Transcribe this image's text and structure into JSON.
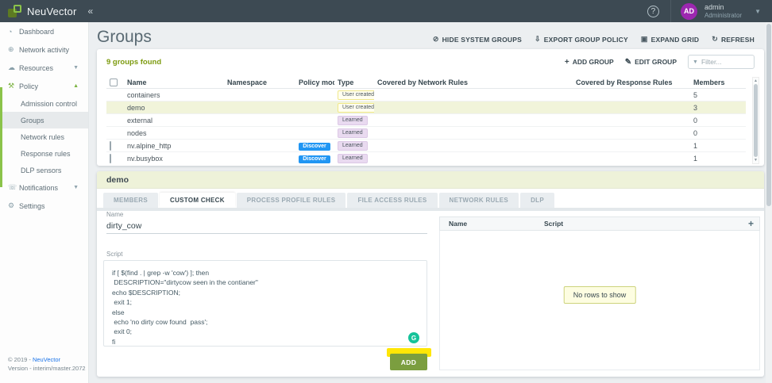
{
  "topbar": {
    "brand": "NeuVector",
    "collapse_icon": "«",
    "help_icon": "?",
    "avatar_initials": "AD",
    "user_name": "admin",
    "user_role": "Administrator",
    "caret_icon": "▼"
  },
  "sidebar": {
    "items": [
      {
        "id": "dashboard",
        "icon": "gauge-icon",
        "glyph": "◔",
        "label": "Dashboard",
        "chevron": ""
      },
      {
        "id": "network-activity",
        "icon": "globe-icon",
        "glyph": "⊕",
        "label": "Network activity",
        "chevron": ""
      },
      {
        "id": "resources",
        "icon": "cloud-icon",
        "glyph": "☁",
        "label": "Resources",
        "chevron": "▼"
      },
      {
        "id": "policy",
        "icon": "gavel-icon",
        "glyph": "⚒",
        "label": "Policy",
        "chevron": "▲",
        "expanded": true,
        "children": [
          "Admission control",
          "Groups",
          "Network rules",
          "Response rules",
          "DLP sensors"
        ],
        "selected_child": "Groups"
      },
      {
        "id": "notifications",
        "icon": "phone-icon",
        "glyph": "☏",
        "label": "Notifications",
        "chevron": "▼"
      },
      {
        "id": "settings",
        "icon": "wrench-icon",
        "glyph": "⚙",
        "label": "Settings",
        "chevron": ""
      }
    ],
    "footer": {
      "copyright": "© 2019 - ",
      "brand_link": "NeuVector",
      "version": "Version - interim/master.2072"
    }
  },
  "page": {
    "title": "Groups",
    "actions": [
      {
        "id": "hide-system-groups",
        "icon": "eye-off-icon",
        "glyph": "⊘",
        "label": "HIDE SYSTEM GROUPS"
      },
      {
        "id": "export-group-policy",
        "icon": "download-icon",
        "glyph": "⇩",
        "label": "EXPORT GROUP POLICY"
      },
      {
        "id": "expand-grid",
        "icon": "window-icon",
        "glyph": "▣",
        "label": "EXPAND GRID"
      },
      {
        "id": "refresh",
        "icon": "refresh-icon",
        "glyph": "↻",
        "label": "REFRESH"
      }
    ]
  },
  "groups": {
    "count_text": "9 groups found",
    "add_label": "ADD GROUP",
    "add_icon": "+",
    "edit_label": "EDIT GROUP",
    "edit_icon": "✎",
    "filter_icon": "▼",
    "filter_placeholder": "Filter...",
    "columns": [
      "Name",
      "Namespace",
      "Policy mode",
      "Type",
      "Covered by Network Rules",
      "Covered by Response Rules",
      "Members"
    ],
    "rows": [
      {
        "name": "containers",
        "namespace": "",
        "policy_mode": "",
        "type": "User created",
        "covered_network": "",
        "covered_response": "",
        "members": "5",
        "has_checkbox": false,
        "highlighted": false
      },
      {
        "name": "demo",
        "namespace": "",
        "policy_mode": "",
        "type": "User created",
        "covered_network": "",
        "covered_response": "",
        "members": "3",
        "has_checkbox": false,
        "highlighted": true
      },
      {
        "name": "external",
        "namespace": "",
        "policy_mode": "",
        "type": "Learned",
        "covered_network": "",
        "covered_response": "",
        "members": "0",
        "has_checkbox": false,
        "highlighted": false
      },
      {
        "name": "nodes",
        "namespace": "",
        "policy_mode": "",
        "type": "Learned",
        "covered_network": "",
        "covered_response": "",
        "members": "0",
        "has_checkbox": false,
        "highlighted": false
      },
      {
        "name": "nv.alpine_http",
        "namespace": "",
        "policy_mode": "Discover",
        "type": "Learned",
        "covered_network": "",
        "covered_response": "",
        "members": "1",
        "has_checkbox": true,
        "highlighted": false
      },
      {
        "name": "nv.busybox",
        "namespace": "",
        "policy_mode": "Discover",
        "type": "Learned",
        "covered_network": "",
        "covered_response": "",
        "members": "1",
        "has_checkbox": true,
        "highlighted": false
      }
    ]
  },
  "detail": {
    "title": "demo",
    "tabs": [
      {
        "label": "MEMBERS",
        "active": false
      },
      {
        "label": "CUSTOM CHECK",
        "active": true
      },
      {
        "label": "PROCESS PROFILE RULES",
        "active": false
      },
      {
        "label": "FILE ACCESS RULES",
        "active": false
      },
      {
        "label": "NETWORK RULES",
        "active": false
      },
      {
        "label": "DLP",
        "active": false
      }
    ],
    "name_label": "Name",
    "name_value": "dirty_cow",
    "script_label": "Script",
    "script_value": "if [ $(find . | grep -w 'cow') ]; then\n DESCRIPTION=\"dirtycow seen in the contianer\"\necho $DESCRIPTION;\n exit 1;\nelse\n echo 'no dirty cow found  pass';\n exit 0;\nfi",
    "grammarly_icon": "G",
    "add_label": "ADD",
    "scripts_table": {
      "columns": [
        "Name",
        "Script"
      ],
      "add_icon": "+",
      "empty_text": "No rows to show"
    }
  },
  "colors": {
    "topbar_bg": "#3d4a53",
    "accent_green": "#8bc34a",
    "button_green": "#7b9e3f",
    "discover_blue": "#2196f3",
    "avatar_purple": "#9c27b0",
    "highlight_yellow": "#ffe606",
    "row_highlight": "#f1f4da",
    "panel_header_bg": "#eef2d9"
  }
}
